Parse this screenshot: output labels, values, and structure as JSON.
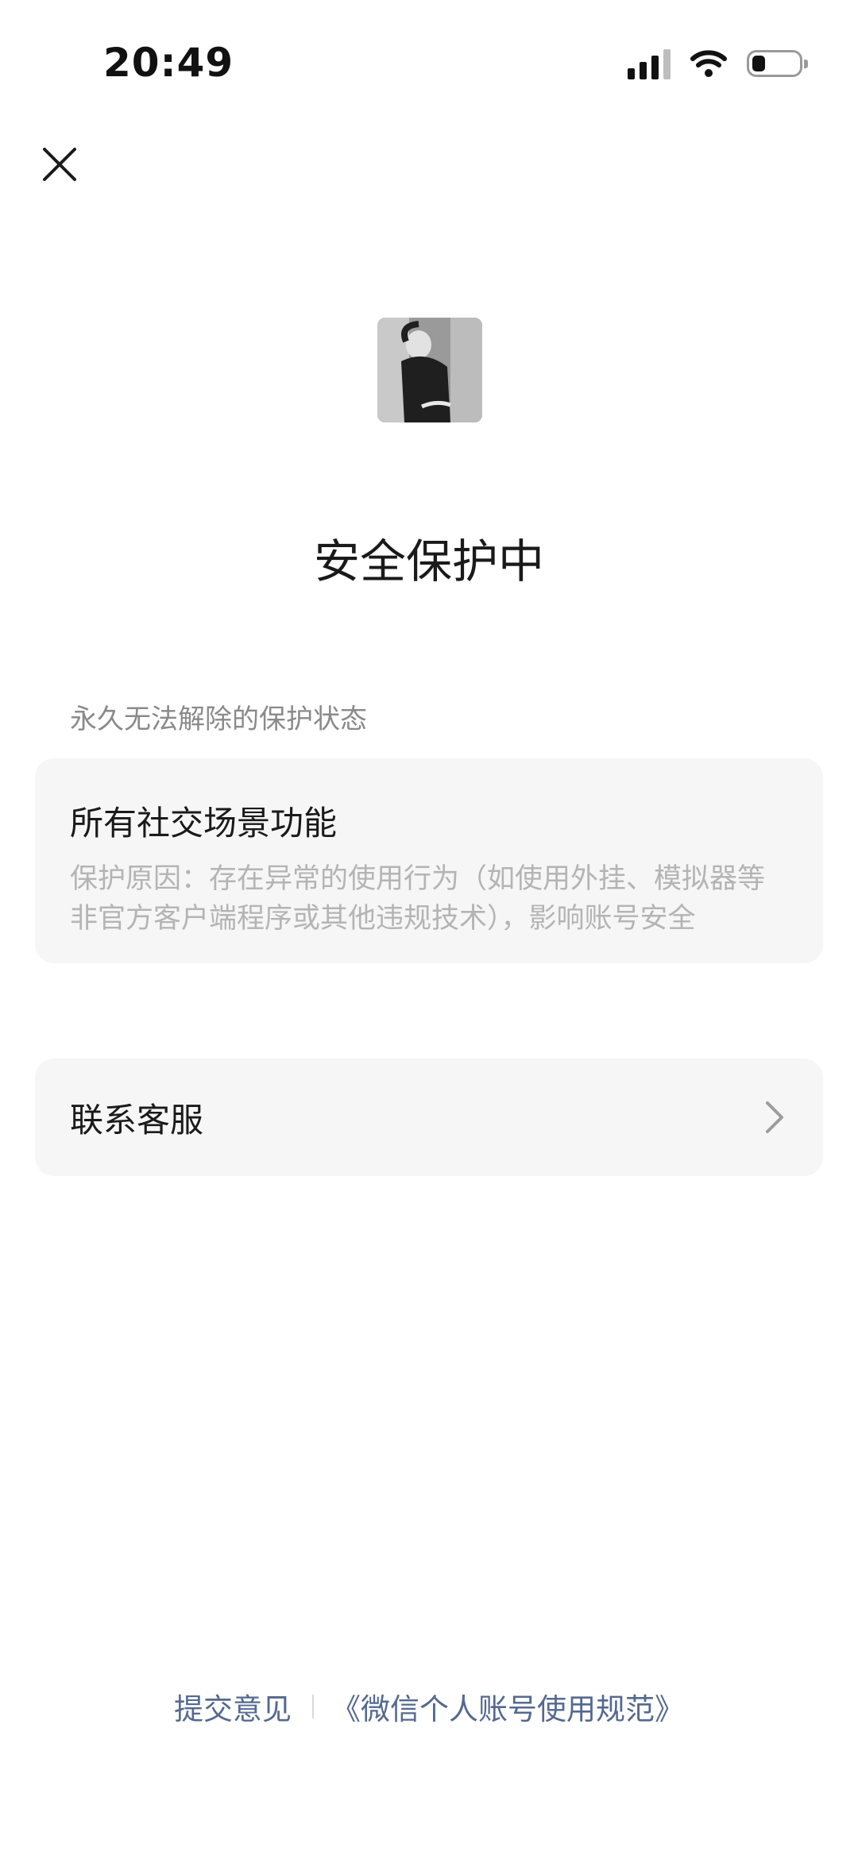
{
  "status_bar": {
    "time": "20:49",
    "signal_icon": "cellular-signal-icon",
    "wifi_icon": "wifi-icon",
    "battery_icon": "battery-icon"
  },
  "nav": {
    "close_icon": "close-icon"
  },
  "avatar_icon": "avatar-photo",
  "title": "安全保护中",
  "section_label": "永久无法解除的保护状态",
  "restriction": {
    "title": "所有社交场景功能",
    "reason_line1": "保护原因：存在异常的使用行为（如使用外挂、模拟器等",
    "reason_line2": "非官方客户端程序或其他违规技术），影响账号安全"
  },
  "contact": {
    "label": "联系客服",
    "chevron_icon": "chevron-right-icon"
  },
  "footer": {
    "feedback_link": "提交意见",
    "policy_link": "《微信个人账号使用规范》"
  },
  "colors": {
    "link": "#55698f",
    "card_bg": "#f6f6f6",
    "muted_text": "#b4b4b4"
  }
}
